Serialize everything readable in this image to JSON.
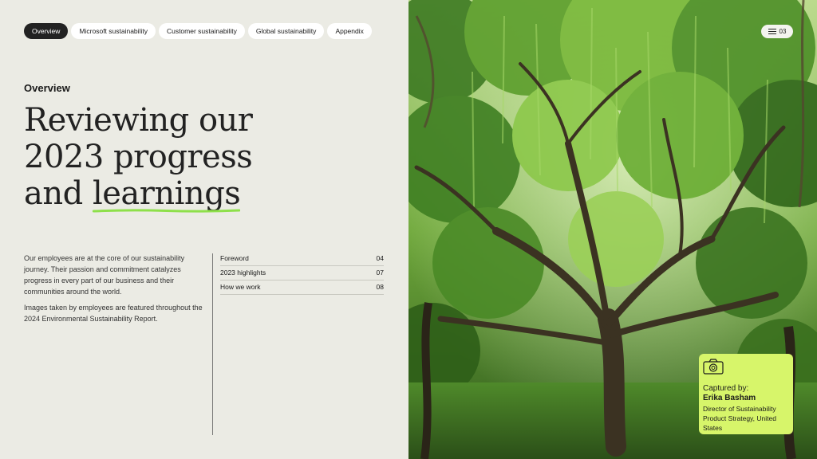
{
  "nav": {
    "tabs": [
      {
        "label": "Overview",
        "active": true
      },
      {
        "label": "Microsoft sustainability",
        "active": false
      },
      {
        "label": "Customer sustainability",
        "active": false
      },
      {
        "label": "Global sustainability",
        "active": false
      },
      {
        "label": "Appendix",
        "active": false
      }
    ]
  },
  "menu": {
    "page_number": "03",
    "icon": "menu-icon"
  },
  "section_label": "Overview",
  "headline": {
    "line1": "Reviewing our",
    "line2": "2023 progress",
    "line3_prefix": "and ",
    "line3_highlight": "learnings",
    "underline_color": "#8ee04a"
  },
  "intro": {
    "p1": "Our employees are at the core of our sustainability journey. Their passion and commitment catalyzes progress in every part of our business and their communities around the world.",
    "p2": "Images taken by employees are featured throughout the 2024 Environmental Sustainability Report."
  },
  "toc": [
    {
      "label": "Foreword",
      "page": "04"
    },
    {
      "label": "2023 highlights",
      "page": "07"
    },
    {
      "label": "How we work",
      "page": "08"
    }
  ],
  "caption": {
    "icon": "camera-icon",
    "label": "Captured by:",
    "name": "Erika Basham",
    "role": "Director of Sustainability Product Strategy, United States",
    "color": "#d7f56a"
  },
  "colors": {
    "background": "#ebebe4",
    "active_tab": "#222222",
    "accent_green": "#8ee04a"
  }
}
